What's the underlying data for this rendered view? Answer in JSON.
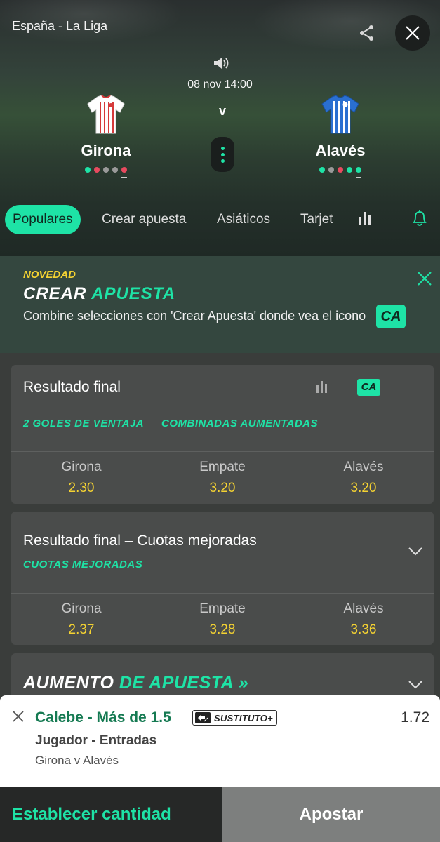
{
  "header": {
    "league": "España - La Liga",
    "datetime": "08 nov 14:00",
    "vs": "v",
    "home": {
      "name": "Girona",
      "form": [
        "#1ee3a6",
        "#e84a5f",
        "#9a9a9a",
        "#9a9a9a",
        "#e84a5f"
      ],
      "kit_color": "#ffffff",
      "kit_stripe": "#d63a3a"
    },
    "away": {
      "name": "Alavés",
      "form": [
        "#1ee3a6",
        "#9a9a9a",
        "#e84a5f",
        "#1ee3a6",
        "#1ee3a6"
      ],
      "kit_color": "#2a6fd1",
      "kit_stripe": "#ffffff"
    }
  },
  "tabs": [
    {
      "label": "Populares",
      "active": true
    },
    {
      "label": "Crear apuesta",
      "active": false
    },
    {
      "label": "Asiáticos",
      "active": false
    },
    {
      "label": "Tarjet",
      "active": false
    }
  ],
  "promo": {
    "tag": "NOVEDAD",
    "title_a": "CREAR",
    "title_b": "APUESTA",
    "text": "Combine selecciones con 'Crear Apuesta' donde vea el icono",
    "badge": "CA"
  },
  "markets": [
    {
      "title": "Resultado final",
      "badge": "CA",
      "tags": [
        "2 GOLES DE VENTAJA",
        "COMBINADAS AUMENTADAS"
      ],
      "selections": [
        {
          "name": "Girona",
          "odds": "2.30"
        },
        {
          "name": "Empate",
          "odds": "3.20"
        },
        {
          "name": "Alavés",
          "odds": "3.20"
        }
      ]
    },
    {
      "title": "Resultado final – Cuotas mejoradas",
      "tags": [
        "CUOTAS MEJORADAS"
      ],
      "selections": [
        {
          "name": "Girona",
          "odds": "2.37"
        },
        {
          "name": "Empate",
          "odds": "3.28"
        },
        {
          "name": "Alavés",
          "odds": "3.36"
        }
      ]
    }
  ],
  "boost": {
    "title_a": "AUMENTO",
    "title_b": "DE APUESTA",
    "arrows": "»"
  },
  "betslip": {
    "selection": "Calebe - Más de 1.5",
    "badge": "SUSTITUTO+",
    "odds": "1.72",
    "market": "Jugador - Entradas",
    "event": "Girona v Alavés"
  },
  "footer": {
    "stake_label": "Establecer cantidad",
    "bet_label": "Apostar"
  },
  "colors": {
    "accent": "#1ee3a6",
    "odds": "#f4d232",
    "card": "#4a4c4b",
    "slip_selection": "#157a52"
  }
}
